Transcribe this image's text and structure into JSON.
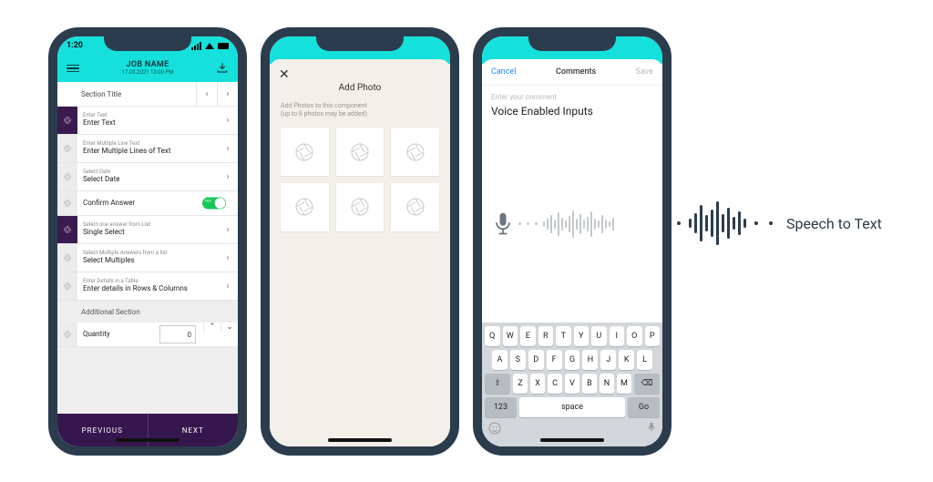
{
  "phone1": {
    "time": "1:20",
    "job_name": "JOB NAME",
    "job_ts": "17.03.2021   13:00 PM",
    "section_title": "Section Title",
    "rows": [
      {
        "hint": "Enter Text",
        "main": "Enter Text"
      },
      {
        "hint": "Enter Multiple Line Text",
        "main": "Enter Multiple Lines of Text"
      },
      {
        "hint": "Select Date",
        "main": "Select Date"
      }
    ],
    "confirm_label": "Confirm Answer",
    "toggle_yes": "YES",
    "rows2": [
      {
        "hint": "Select one answer from List",
        "main": "Single Select"
      },
      {
        "hint": "Select Multiple Answers from a list",
        "main": "Select Multiples"
      },
      {
        "hint": "Enter Details in a Table",
        "main": "Enter details in Rows & Columns"
      }
    ],
    "additional_section": "Additional Section",
    "quantity_label": "Quantity",
    "quantity_value": "0",
    "prev": "PREVIOUS",
    "next": "NEXT"
  },
  "phone2": {
    "title": "Add Photo",
    "sub_line1": "Add Photos to this component",
    "sub_line2": "(up to 6 photos may be added)"
  },
  "phone3": {
    "cancel": "Cancel",
    "title": "Comments",
    "save": "Save",
    "placeholder": "Enter your comment",
    "entered": "Voice Enabled Inputs",
    "keys_r1": [
      "Q",
      "W",
      "E",
      "R",
      "T",
      "Y",
      "U",
      "I",
      "O",
      "P"
    ],
    "keys_r2": [
      "A",
      "S",
      "D",
      "F",
      "G",
      "H",
      "J",
      "K",
      "L"
    ],
    "keys_r3": [
      "Z",
      "X",
      "C",
      "V",
      "B",
      "N",
      "M"
    ],
    "key_123": "123",
    "space": "space",
    "go": "Go"
  },
  "external_label": "Speech to Text"
}
